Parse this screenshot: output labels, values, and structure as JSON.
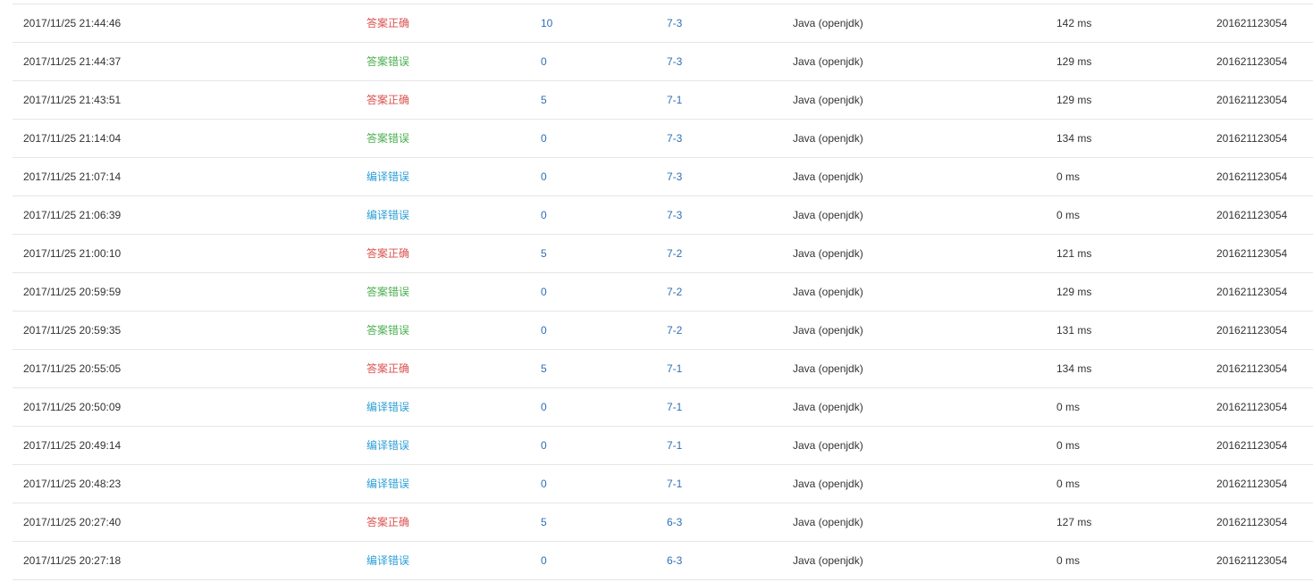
{
  "colors": {
    "correct": "#d9534f",
    "wrong": "#4caf50",
    "compile_error": "#2f9fd6",
    "link": "#2f6fb5",
    "divider": "#e6e6e6"
  },
  "rows": [
    {
      "time": "2017/11/25 21:44:46",
      "status": "答案正确",
      "status_type": "correct",
      "score": "10",
      "problem": "7-3",
      "language": "Java (openjdk)",
      "run_time": "142 ms",
      "user": "201621123054"
    },
    {
      "time": "2017/11/25 21:44:37",
      "status": "答案错误",
      "status_type": "wrong",
      "score": "0",
      "problem": "7-3",
      "language": "Java (openjdk)",
      "run_time": "129 ms",
      "user": "201621123054"
    },
    {
      "time": "2017/11/25 21:43:51",
      "status": "答案正确",
      "status_type": "correct",
      "score": "5",
      "problem": "7-1",
      "language": "Java (openjdk)",
      "run_time": "129 ms",
      "user": "201621123054"
    },
    {
      "time": "2017/11/25 21:14:04",
      "status": "答案错误",
      "status_type": "wrong",
      "score": "0",
      "problem": "7-3",
      "language": "Java (openjdk)",
      "run_time": "134 ms",
      "user": "201621123054"
    },
    {
      "time": "2017/11/25 21:07:14",
      "status": "编译错误",
      "status_type": "compile",
      "score": "0",
      "problem": "7-3",
      "language": "Java (openjdk)",
      "run_time": "0 ms",
      "user": "201621123054"
    },
    {
      "time": "2017/11/25 21:06:39",
      "status": "编译错误",
      "status_type": "compile",
      "score": "0",
      "problem": "7-3",
      "language": "Java (openjdk)",
      "run_time": "0 ms",
      "user": "201621123054"
    },
    {
      "time": "2017/11/25 21:00:10",
      "status": "答案正确",
      "status_type": "correct",
      "score": "5",
      "problem": "7-2",
      "language": "Java (openjdk)",
      "run_time": "121 ms",
      "user": "201621123054"
    },
    {
      "time": "2017/11/25 20:59:59",
      "status": "答案错误",
      "status_type": "wrong",
      "score": "0",
      "problem": "7-2",
      "language": "Java (openjdk)",
      "run_time": "129 ms",
      "user": "201621123054"
    },
    {
      "time": "2017/11/25 20:59:35",
      "status": "答案错误",
      "status_type": "wrong",
      "score": "0",
      "problem": "7-2",
      "language": "Java (openjdk)",
      "run_time": "131 ms",
      "user": "201621123054"
    },
    {
      "time": "2017/11/25 20:55:05",
      "status": "答案正确",
      "status_type": "correct",
      "score": "5",
      "problem": "7-1",
      "language": "Java (openjdk)",
      "run_time": "134 ms",
      "user": "201621123054"
    },
    {
      "time": "2017/11/25 20:50:09",
      "status": "编译错误",
      "status_type": "compile",
      "score": "0",
      "problem": "7-1",
      "language": "Java (openjdk)",
      "run_time": "0 ms",
      "user": "201621123054"
    },
    {
      "time": "2017/11/25 20:49:14",
      "status": "编译错误",
      "status_type": "compile",
      "score": "0",
      "problem": "7-1",
      "language": "Java (openjdk)",
      "run_time": "0 ms",
      "user": "201621123054"
    },
    {
      "time": "2017/11/25 20:48:23",
      "status": "编译错误",
      "status_type": "compile",
      "score": "0",
      "problem": "7-1",
      "language": "Java (openjdk)",
      "run_time": "0 ms",
      "user": "201621123054"
    },
    {
      "time": "2017/11/25 20:27:40",
      "status": "答案正确",
      "status_type": "correct",
      "score": "5",
      "problem": "6-3",
      "language": "Java (openjdk)",
      "run_time": "127 ms",
      "user": "201621123054"
    },
    {
      "time": "2017/11/25 20:27:18",
      "status": "编译错误",
      "status_type": "compile",
      "score": "0",
      "problem": "6-3",
      "language": "Java (openjdk)",
      "run_time": "0 ms",
      "user": "201621123054"
    }
  ]
}
